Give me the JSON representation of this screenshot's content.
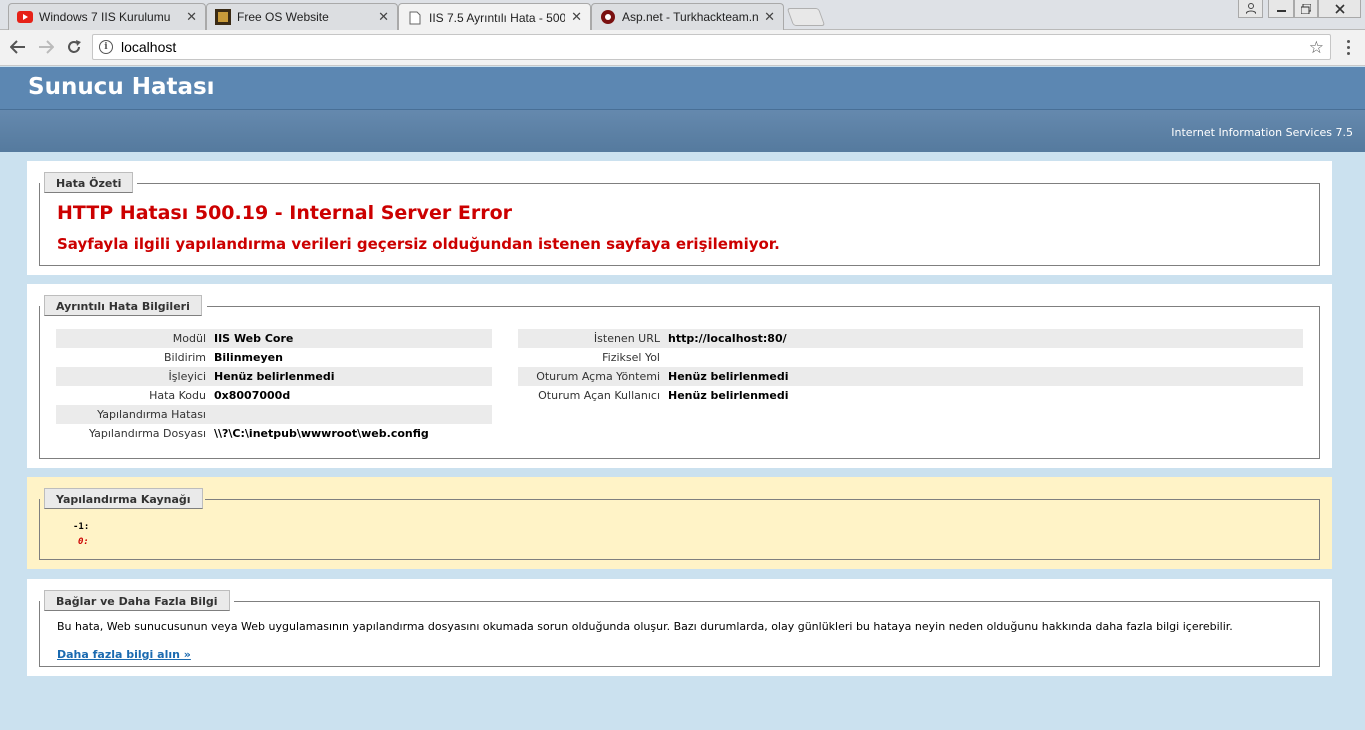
{
  "browser": {
    "tabs": [
      {
        "title": "Windows 7 IIS Kurulumu",
        "icon": "youtube-icon"
      },
      {
        "title": "Free OS Website",
        "icon": "site-favicon-icon"
      },
      {
        "title": "IIS 7.5 Ayrıntılı Hata - 500",
        "icon": "page-icon"
      },
      {
        "title": "Asp.net - Turkhackteam.n",
        "icon": "turkhackteam-icon"
      }
    ],
    "close_glyph": "✕",
    "address": "localhost"
  },
  "page": {
    "title": "Sunucu Hatası",
    "server": "Internet Information Services 7.5",
    "summary": {
      "legend": "Hata Özeti",
      "heading": "HTTP Hatası 500.19 - Internal Server Error",
      "message": "Sayfayla ilgili yapılandırma verileri geçersiz olduğundan istenen sayfaya erişilemiyor."
    },
    "details": {
      "legend": "Ayrıntılı Hata Bilgileri",
      "left": [
        {
          "k": "Modül",
          "v": "IIS Web Core"
        },
        {
          "k": "Bildirim",
          "v": "Bilinmeyen"
        },
        {
          "k": "İşleyici",
          "v": "Henüz belirlenmedi"
        },
        {
          "k": "Hata Kodu",
          "v": "0x8007000d"
        },
        {
          "k": "Yapılandırma Hatası",
          "v": ""
        },
        {
          "k": "Yapılandırma Dosyası",
          "v": "\\\\?\\C:\\inetpub\\wwwroot\\web.config"
        }
      ],
      "right": [
        {
          "k": "İstenen URL",
          "v": "http://localhost:80/"
        },
        {
          "k": "Fiziksel Yol",
          "v": ""
        },
        {
          "k": "Oturum Açma Yöntemi",
          "v": "Henüz belirlenmedi"
        },
        {
          "k": "Oturum Açan Kullanıcı",
          "v": "Henüz belirlenmedi"
        }
      ]
    },
    "config": {
      "legend": "Yapılandırma Kaynağı",
      "line1": "-1:",
      "line2": "0:"
    },
    "links": {
      "legend": "Bağlar ve Daha Fazla Bilgi",
      "text": "Bu hata, Web sunucusunun veya Web uygulamasının yapılandırma dosyasını okumada sorun olduğunda oluşur. Bazı durumlarda, olay günlükleri bu hataya neyin neden olduğunu hakkında daha fazla bilgi içerebilir.",
      "more": "Daha fazla bilgi alın »"
    }
  }
}
